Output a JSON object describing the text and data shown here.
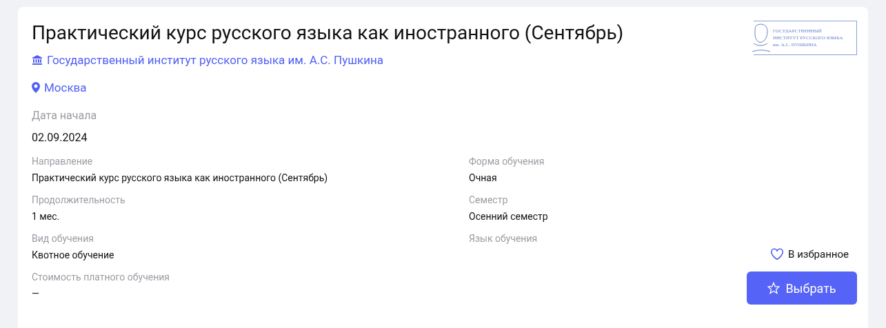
{
  "course": {
    "title": "Практический курс русского языка как иностранного (Сентябрь)",
    "institution": "Государственный институт русского языка им. А.С. Пушкина",
    "city": "Москва",
    "logo_lines": [
      "ГОСУДАРСТВЕННЫЙ",
      "ИНСТИТУТ РУССКОГО ЯЗЫКА",
      "им. А.С. ПУШКИНА"
    ],
    "start_label": "Дата начала",
    "start_value": "02.09.2024",
    "fields": [
      {
        "label": "Направление",
        "value": "Практический курс русского языка как иностранного (Сентябрь)"
      },
      {
        "label": "Форма обучения",
        "value": "Очная"
      },
      {
        "label": "Продолжительность",
        "value": "1 мес."
      },
      {
        "label": "Семестр",
        "value": "Осенний семестр"
      },
      {
        "label": "Вид обучения",
        "value": "Квотное обучение"
      },
      {
        "label": "Язык обучения"
      },
      {
        "label": "Стоимость платного обучения",
        "value": "—"
      }
    ],
    "favorite_label": "В избранное",
    "select_label": "Выбрать"
  }
}
